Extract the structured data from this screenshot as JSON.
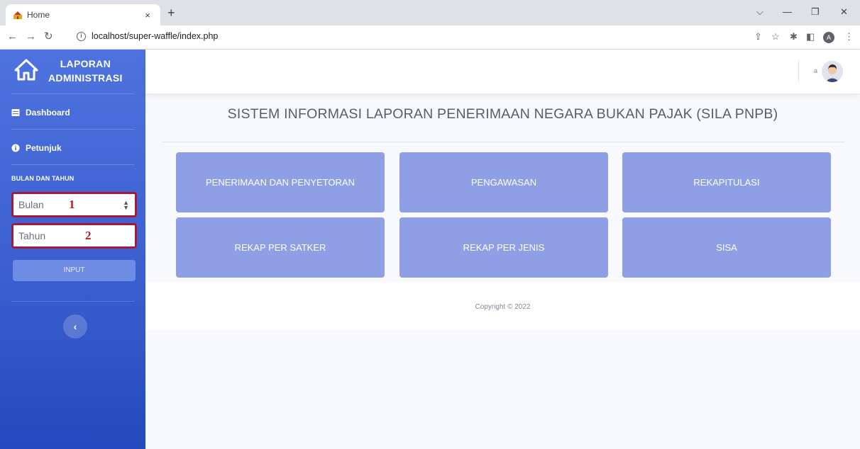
{
  "browser": {
    "tab_title": "Home",
    "url": "localhost/super-waffle/index.php",
    "profile_initial": "A",
    "new_tab_symbol": "+",
    "close_symbol": "×"
  },
  "sidebar": {
    "brand_line1": "LAPORAN",
    "brand_line2": "ADMINISTRASI",
    "nav": [
      {
        "label": "Dashboard",
        "icon": "table-icon"
      },
      {
        "label": "Petunjuk",
        "icon": "info-circle-icon"
      }
    ],
    "section_heading": "BULAN DAN TAHUN",
    "month_select": {
      "value": "Bulan",
      "annotation": "1"
    },
    "year_input": {
      "placeholder": "Tahun",
      "annotation": "2"
    },
    "submit_label": "INPUT",
    "toggle_symbol": "‹"
  },
  "topbar": {
    "user_name": "a"
  },
  "main": {
    "title": "SISTEM INFORMASI LAPORAN PENERIMAAN NEGARA BUKAN PAJAK (SILA PNPB)",
    "buttons": [
      {
        "label": "PENERIMAAN DAN PENYETORAN"
      },
      {
        "label": "PENGAWASAN"
      },
      {
        "label": "REKAPITULASI"
      },
      {
        "label": "REKAP PER SATKER"
      },
      {
        "label": "REKAP PER JENIS"
      },
      {
        "label": "SISA"
      }
    ]
  },
  "footer": {
    "copyright": "Copyright © 2022"
  },
  "colors": {
    "sidebar": "#4e73df",
    "menu_button": "#8f9fe6",
    "annotation_border": "#a01c38"
  }
}
